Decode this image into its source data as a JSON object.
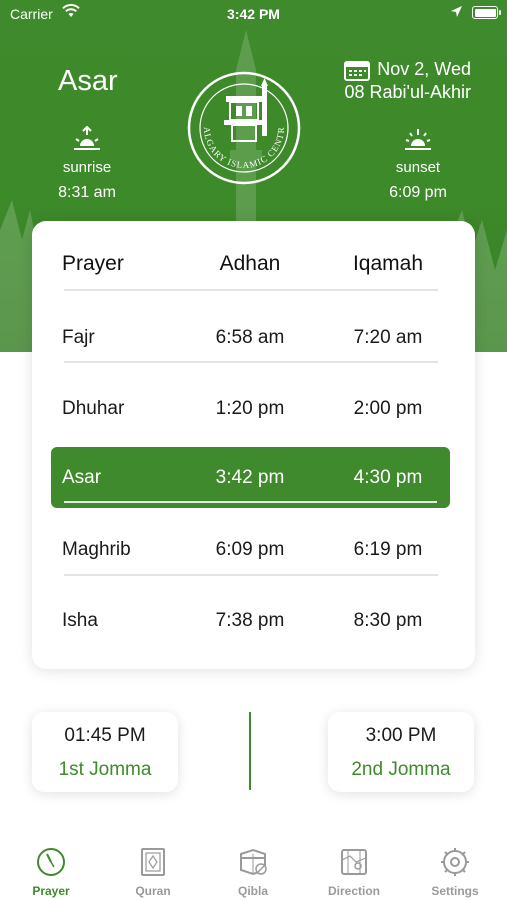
{
  "status_bar": {
    "carrier": "Carrier",
    "time": "3:42 PM"
  },
  "header": {
    "current_prayer": "Asar",
    "logo_text": "CALGARY ISLAMIC CENTRE",
    "date_gregorian": "Nov 2, Wed",
    "date_hijri": "08 Rabi'ul-Akhir",
    "sunrise_label": "sunrise",
    "sunrise_time": "8:31 am",
    "sunset_label": "sunset",
    "sunset_time": "6:09 pm"
  },
  "table": {
    "headers": [
      "Prayer",
      "Adhan",
      "Iqamah"
    ],
    "rows": [
      {
        "prayer": "Fajr",
        "adhan": "6:58 am",
        "iqamah": "7:20 am"
      },
      {
        "prayer": "Dhuhar",
        "adhan": "1:20 pm",
        "iqamah": "2:00 pm"
      },
      {
        "prayer": "Asar",
        "adhan": "3:42 pm",
        "iqamah": "4:30 pm"
      },
      {
        "prayer": "Maghrib",
        "adhan": "6:09 pm",
        "iqamah": "6:19 pm"
      },
      {
        "prayer": "Isha",
        "adhan": "7:38 pm",
        "iqamah": "8:30 pm"
      }
    ],
    "active_row": "Asar"
  },
  "jomma": [
    {
      "time": "01:45 PM",
      "name": "1st Jomma"
    },
    {
      "time": "3:00 PM",
      "name": "2nd Jomma"
    }
  ],
  "tabs": [
    {
      "label": "Prayer",
      "icon": "clock-icon",
      "active": true
    },
    {
      "label": "Quran",
      "icon": "quran-book-icon",
      "active": false
    },
    {
      "label": "Qibla",
      "icon": "kaaba-icon",
      "active": false
    },
    {
      "label": "Direction",
      "icon": "map-icon",
      "active": false
    },
    {
      "label": "Settings",
      "icon": "gear-icon",
      "active": false
    }
  ],
  "colors": {
    "brand_green": "#3f8a2c",
    "inactive_tab": "#9a9a9a"
  }
}
